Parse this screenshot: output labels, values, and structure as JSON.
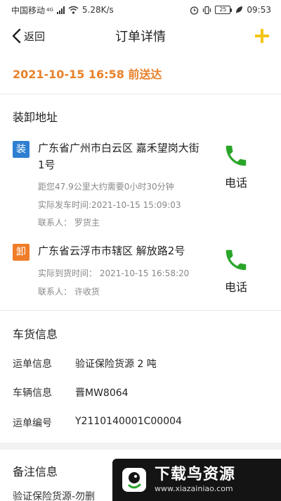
{
  "status_bar": {
    "carrier": "中国移动",
    "network": "4G",
    "speed": "5.28K/s",
    "battery": "25",
    "time": "09:53"
  },
  "nav": {
    "back_label": "返回",
    "title": "订单详情",
    "add_icon": "plus-icon",
    "accent": "#f5c518"
  },
  "delivery": {
    "text": "2021-10-15 16:58 前送达",
    "color": "#e8812a"
  },
  "addresses": {
    "title": "装卸地址",
    "load": {
      "tag": "装",
      "tag_color": "#2f7fd1",
      "address": "广东省广州市白云区 嘉禾望岗大街1号",
      "distance": "距您47.9公里大约需要0小时30分钟",
      "depart_time": "实际发车时间:2021-10-15 15:09:03",
      "contact": "联系人：  罗货主",
      "call_label": "电话"
    },
    "unload": {
      "tag": "卸",
      "tag_color": "#f07c28",
      "address": "广东省云浮市市辖区 解放路2号",
      "arrive_time": "实际到货时间：  2021-10-15 16:58:20",
      "contact": "联系人：  许收货",
      "call_label": "电话"
    },
    "phone_color": "#2aa52a"
  },
  "cargo": {
    "title": "车货信息",
    "rows": [
      {
        "label": "运单信息",
        "value": "验证保险货源 2 吨"
      },
      {
        "label": "车辆信息",
        "value": "晋MW8064"
      },
      {
        "label": "运单编号",
        "value": "Y2110140001C00004"
      }
    ]
  },
  "remarks": {
    "title": "备注信息",
    "text": "验证保险货源-勿删"
  },
  "watermark": {
    "title": "下载鸟资源",
    "url": "www.xiazainiao.com"
  }
}
